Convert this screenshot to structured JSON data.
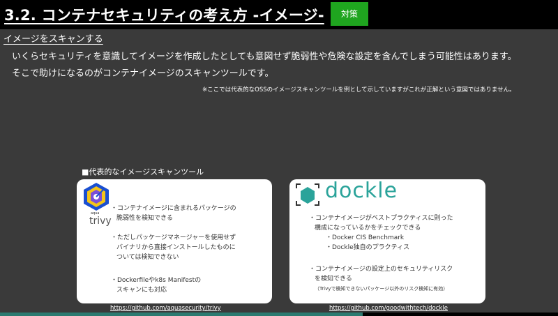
{
  "header": {
    "title": "3.2. コンテナセキュリティの考え方 -イメージ-",
    "badge": "対策"
  },
  "main": {
    "subheading": "イメージをスキャンする",
    "paragraph": [
      "いくらセキュリティを意識してイメージを作成したとしても意図せず脆弱性や危険な設定を含んでしまう可能性はあります。",
      "そこで助けになるのがコンテナイメージのスキャンツールです。"
    ],
    "note": "※ここでは代表的なOSSのイメージスキャンツールを例として示していますがこれが正解という意図ではありません。",
    "section_title": "■代表的なイメージスキャンツール"
  },
  "cards": {
    "trivy": {
      "logo_small": "aqua",
      "logo_name": "trivy",
      "bullets": [
        "・コンテナイメージに含まれるパッケージの",
        "脆弱性を検知できる",
        "・ただしパッケージマネージャーを使用せず",
        "バイナリから直接インストールしたものに",
        "ついては検知できない",
        "・Dockerfileやk8s Manifestの",
        "スキャンにも対応"
      ],
      "link": "https://github.com/aquasecurity/trivy"
    },
    "dockle": {
      "logo_name": "dockle",
      "bullets": [
        "・コンテナイメージがベストプラクティスに則った",
        "構成になっているかをチェックできる",
        "・Docker CIS Benchmark",
        "・Dockle独自のプラクティス",
        "・コンテナイメージの設定上のセキュリティリスク",
        "を検知できる",
        "（Trivyで検知できないパッケージ以外のリスク検知に有効）"
      ],
      "link": "https://github.com/goodwithtech/dockle"
    }
  },
  "footer": {
    "progress_fraction": 0.65
  },
  "colors": {
    "background": "#3a3a3a",
    "badge": "#1fa51f",
    "dockle": "#2aa39a",
    "trivy_blue": "#1a4fd1",
    "trivy_yellow": "#f5c518"
  }
}
